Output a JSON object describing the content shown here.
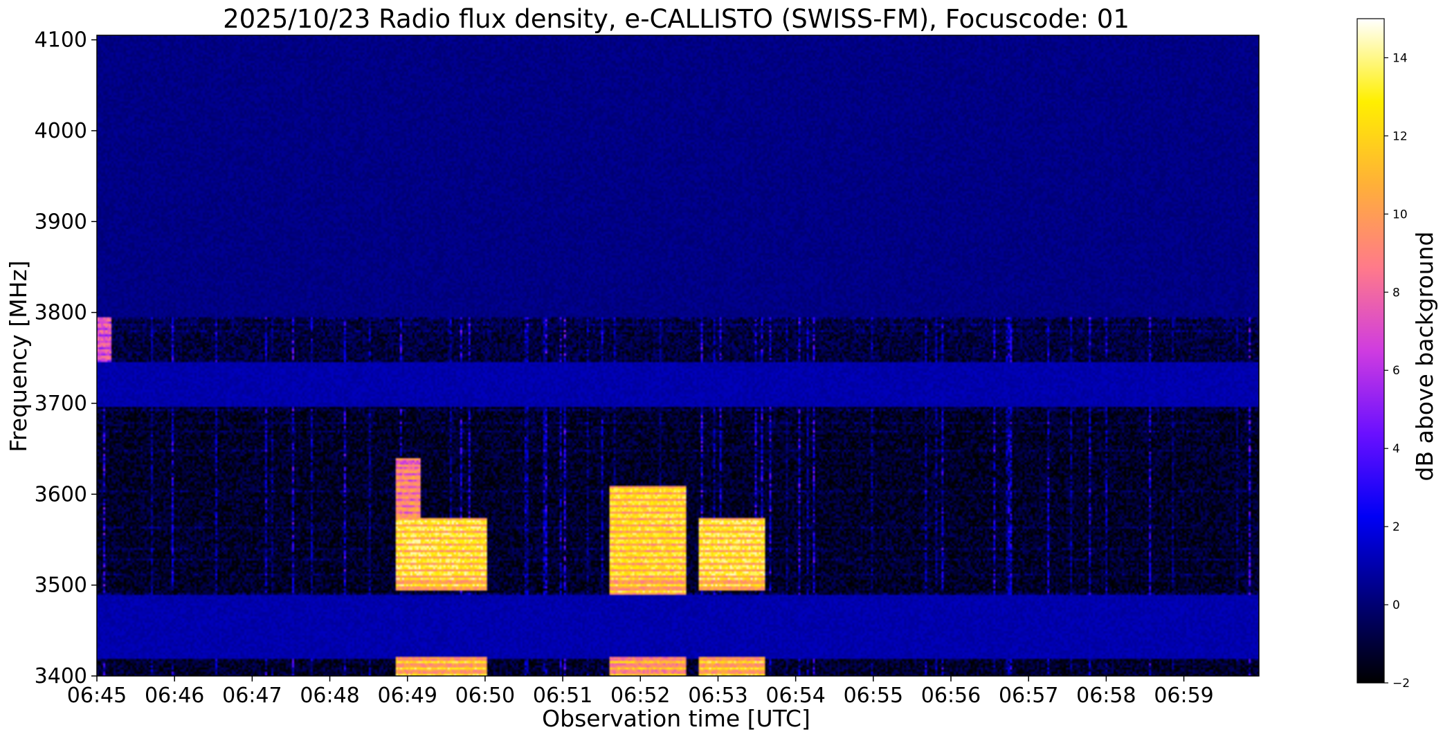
{
  "chart_data": {
    "type": "heatmap",
    "title": "2025/10/23  Radio flux density, e-CALLISTO (SWISS-FM), Focuscode: 01",
    "xlabel": "Observation time [UTC]",
    "ylabel": "Frequency [MHz]",
    "colorbar_label": "dB above background",
    "x_ticks": [
      "06:45",
      "06:46",
      "06:47",
      "06:48",
      "06:49",
      "06:50",
      "06:51",
      "06:52",
      "06:53",
      "06:54",
      "06:55",
      "06:56",
      "06:57",
      "06:58",
      "06:59"
    ],
    "xlim": [
      "06:45:00",
      "06:59:58"
    ],
    "y_ticks": [
      3400,
      3500,
      3600,
      3700,
      3800,
      3900,
      4000,
      4100
    ],
    "ylim": [
      3400,
      4105
    ],
    "colorbar_ticks": [
      -2,
      0,
      2,
      4,
      6,
      8,
      10,
      12,
      14
    ],
    "clim": [
      -2,
      15
    ],
    "colormap": "gnuplot2",
    "colormap_stops": [
      "#000000",
      "#00007a",
      "#0000f5",
      "#6a10ff",
      "#cf3ce0",
      "#ff7a8a",
      "#ffb038",
      "#ffef00",
      "#ffffff"
    ],
    "background_level_db": 0,
    "frequency_bands": [
      {
        "from_mhz": 3400,
        "to_mhz": 3418,
        "description_level_db": -1.2
      },
      {
        "from_mhz": 3418,
        "to_mhz": 3490,
        "description_level_db": 1.0
      },
      {
        "from_mhz": 3490,
        "to_mhz": 3695,
        "description_level_db": -1.3
      },
      {
        "from_mhz": 3695,
        "to_mhz": 3745,
        "description_level_db": 1.0
      },
      {
        "from_mhz": 3745,
        "to_mhz": 3795,
        "description_level_db": -0.9
      },
      {
        "from_mhz": 3795,
        "to_mhz": 4105,
        "description_level_db": 0.3
      }
    ],
    "bursts": [
      {
        "start": "06:48:50",
        "end": "06:50:00",
        "freq_from_mhz": 3495,
        "freq_to_mhz": 3575,
        "peak_db": 14.5
      },
      {
        "start": "06:48:50",
        "end": "06:49:10",
        "freq_from_mhz": 3575,
        "freq_to_mhz": 3640,
        "peak_db": 11
      },
      {
        "start": "06:48:50",
        "end": "06:50:00",
        "freq_from_mhz": 3400,
        "freq_to_mhz": 3420,
        "peak_db": 14
      },
      {
        "start": "06:51:35",
        "end": "06:52:35",
        "freq_from_mhz": 3490,
        "freq_to_mhz": 3610,
        "peak_db": 14
      },
      {
        "start": "06:51:35",
        "end": "06:52:35",
        "freq_from_mhz": 3400,
        "freq_to_mhz": 3420,
        "peak_db": 13
      },
      {
        "start": "06:52:45",
        "end": "06:53:35",
        "freq_from_mhz": 3495,
        "freq_to_mhz": 3575,
        "peak_db": 14.5
      },
      {
        "start": "06:52:45",
        "end": "06:53:35",
        "freq_from_mhz": 3400,
        "freq_to_mhz": 3420,
        "peak_db": 14
      },
      {
        "start": "06:45:00",
        "end": "06:45:10",
        "freq_from_mhz": 3745,
        "freq_to_mhz": 3795,
        "peak_db": 9
      }
    ]
  }
}
